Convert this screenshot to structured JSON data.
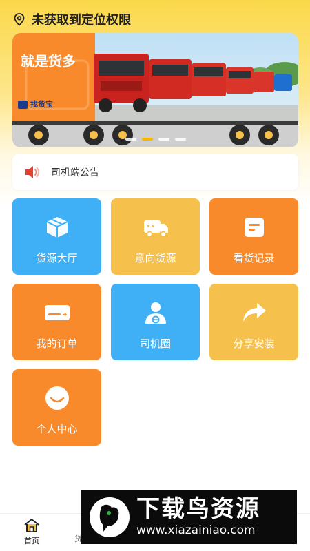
{
  "location": {
    "text": "未获取到定位权限",
    "icon": "location-pin-icon"
  },
  "banner": {
    "slogan": "就是货多",
    "brand": "找货宝",
    "dot_count": 4,
    "active_dot": 1
  },
  "notice": {
    "icon": "speaker-icon",
    "text": "司机端公告"
  },
  "tiles": [
    {
      "label": "货源大厅",
      "icon": "box-icon",
      "color": "#3fb0f5"
    },
    {
      "label": "意向货源",
      "icon": "truck-icon",
      "color": "#f5c04c"
    },
    {
      "label": "看货记录",
      "icon": "note-icon",
      "color": "#f98a2b"
    },
    {
      "label": "我的订单",
      "icon": "card-icon",
      "color": "#f98a2b"
    },
    {
      "label": "司机圈",
      "icon": "driver-icon",
      "color": "#3fb0f5"
    },
    {
      "label": "分享安装",
      "icon": "share-icon",
      "color": "#f5c04c"
    },
    {
      "label": "个人中心",
      "icon": "smile-icon",
      "color": "#f98a2b"
    }
  ],
  "nav": {
    "home_label": "首页",
    "partial_label": "货"
  },
  "watermark": {
    "title": "下载鸟资源",
    "url": "www.xiazainiao.com"
  }
}
